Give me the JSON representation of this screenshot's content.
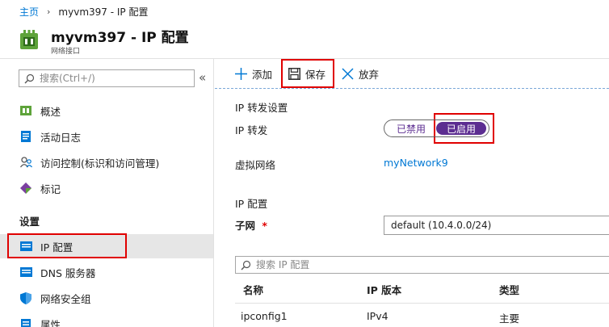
{
  "breadcrumb": {
    "home": "主页",
    "current": "myvm397 - IP 配置"
  },
  "header": {
    "title": "myvm397 - IP 配置",
    "subtitle": "网络接口"
  },
  "sidebar": {
    "search_placeholder": "搜索(Ctrl+/)",
    "items": [
      {
        "label": "概述",
        "icon": "overview-icon"
      },
      {
        "label": "活动日志",
        "icon": "activity-log-icon"
      },
      {
        "label": "访问控制(标识和访问管理)",
        "icon": "access-control-icon"
      },
      {
        "label": "标记",
        "icon": "tag-icon"
      }
    ],
    "section_label": "设置",
    "settings_items": [
      {
        "label": "IP 配置",
        "icon": "ip-config-icon",
        "active": true
      },
      {
        "label": "DNS 服务器",
        "icon": "dns-icon"
      },
      {
        "label": "网络安全组",
        "icon": "nsg-icon"
      },
      {
        "label": "属性",
        "icon": "properties-icon"
      }
    ]
  },
  "toolbar": {
    "add_label": "添加",
    "save_label": "保存",
    "discard_label": "放弃"
  },
  "content": {
    "forwarding_section": "IP 转发设置",
    "forwarding_label": "IP 转发",
    "toggle_disabled": "已禁用",
    "toggle_enabled": "已启用",
    "toggle_state": "enabled",
    "vnet_label": "虚拟网络",
    "vnet_value": "myNetwork9",
    "ipconfig_section": "IP 配置",
    "subnet_label": "子网",
    "subnet_required": "*",
    "subnet_value": "default (10.4.0.0/24)",
    "search_placeholder": "搜索 IP 配置",
    "table": {
      "headers": [
        "名称",
        "IP 版本",
        "类型"
      ],
      "rows": [
        [
          "ipconfig1",
          "IPv4",
          "主要"
        ]
      ]
    }
  },
  "colors": {
    "accent": "#0078d4",
    "toggle": "#5c2d91",
    "highlight": "#e00000"
  }
}
